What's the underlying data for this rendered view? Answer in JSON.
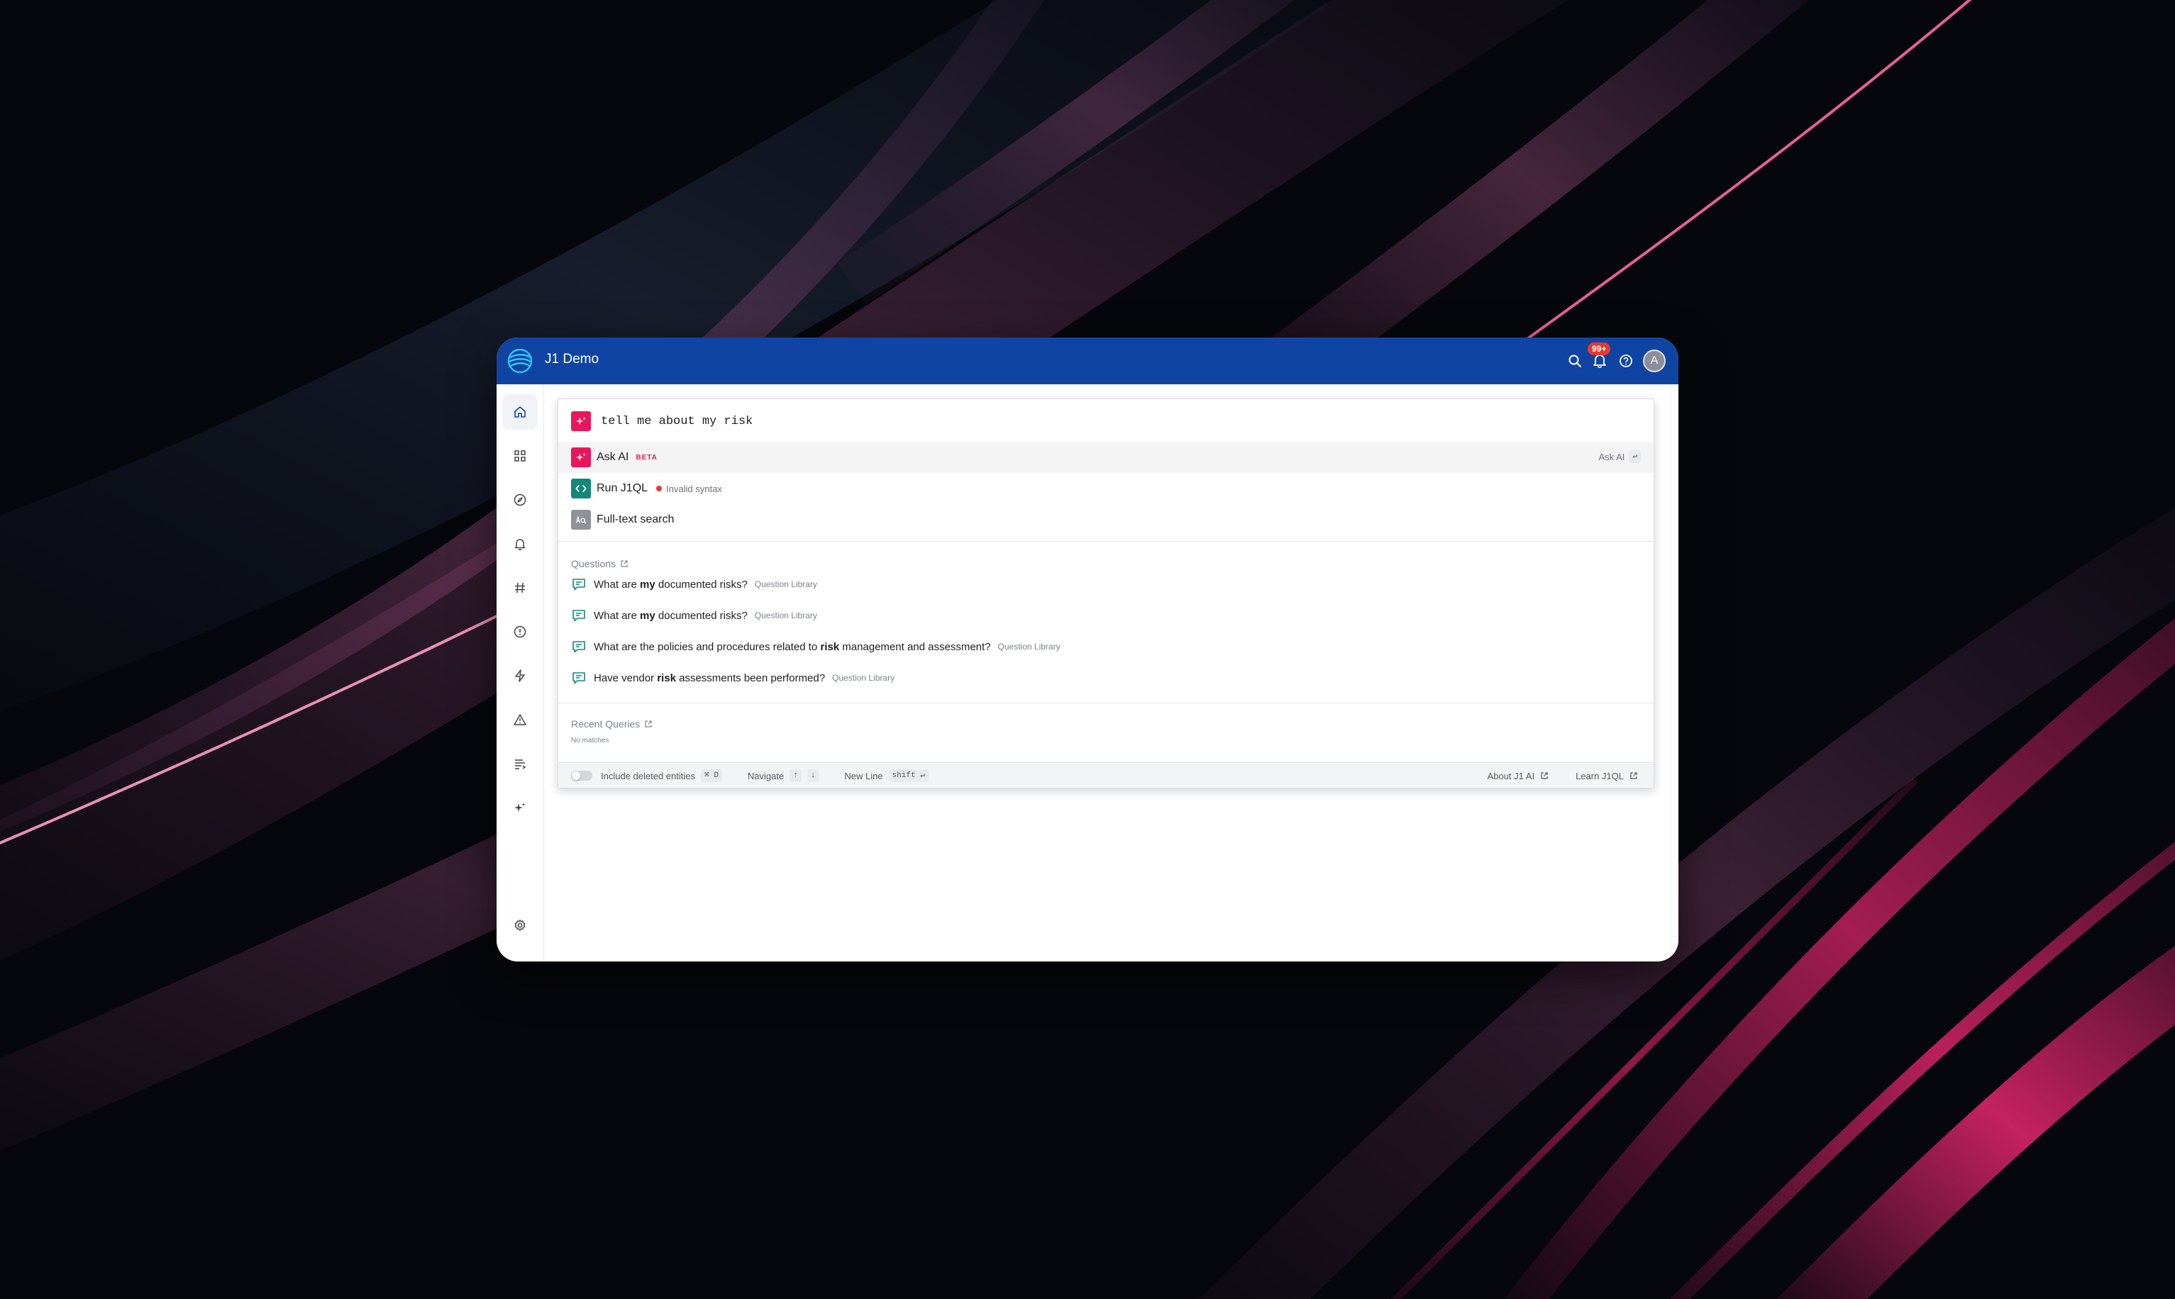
{
  "app": {
    "title": "J1 Demo"
  },
  "header": {
    "notification_count": "99+",
    "avatar_initial": "A"
  },
  "sidebar": {
    "items": [
      {
        "icon": "home-icon",
        "active": true
      },
      {
        "icon": "apps-grid-icon"
      },
      {
        "icon": "compass-icon"
      },
      {
        "icon": "bell-icon"
      },
      {
        "icon": "hashtag-icon"
      },
      {
        "icon": "alert-circle-icon"
      },
      {
        "icon": "lightning-icon"
      },
      {
        "icon": "warning-triangle-icon"
      },
      {
        "icon": "list-icon"
      },
      {
        "icon": "sparkle-icon"
      },
      {
        "icon": "gear-icon"
      }
    ]
  },
  "search": {
    "value": "tell me about my risk"
  },
  "options": {
    "ask_ai": {
      "label": "Ask AI",
      "badge": "BETA",
      "hint": "Ask AI",
      "hint_key": "↵"
    },
    "run_j1ql": {
      "label": "Run J1QL",
      "status": "Invalid syntax"
    },
    "full_text": {
      "label": "Full-text search"
    }
  },
  "questions": {
    "heading": "Questions",
    "items": [
      {
        "before": "What are ",
        "bold": "my",
        "after": " documented risks?",
        "source": "Question Library"
      },
      {
        "before": "What are ",
        "bold": "my",
        "after": " documented risks?",
        "source": "Question Library"
      },
      {
        "before": "What are the policies and procedures related to ",
        "bold": "risk",
        "after": " management and assessment?",
        "source": "Question Library"
      },
      {
        "before": "Have vendor ",
        "bold": "risk",
        "after": " assessments been performed?",
        "source": "Question Library"
      }
    ]
  },
  "recent": {
    "heading": "Recent Queries",
    "empty": "No matches"
  },
  "footer": {
    "include_deleted": "Include deleted entities",
    "include_deleted_key": "⌘ D",
    "navigate": "Navigate",
    "navigate_up": "↑",
    "navigate_down": "↓",
    "new_line": "New Line",
    "new_line_key": "shift ↵",
    "about": "About J1 AI",
    "learn": "Learn J1QL"
  },
  "colors": {
    "topbar": "#0f44a3",
    "ai_accent": "#e8175d",
    "j1ql_accent": "#14877a",
    "error": "#e53935"
  }
}
